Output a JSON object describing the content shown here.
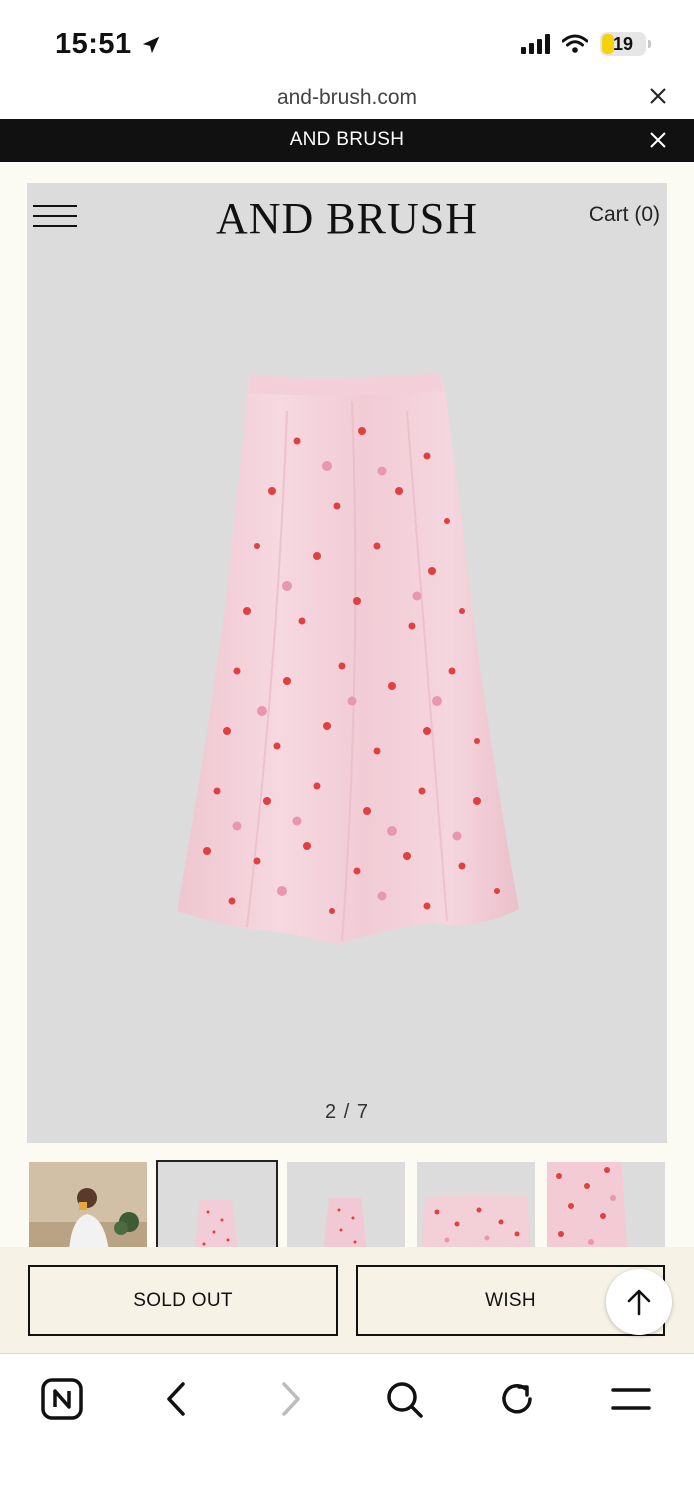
{
  "status_bar": {
    "time": "15:51",
    "battery": "19"
  },
  "url_bar": {
    "domain": "and-brush.com"
  },
  "announcement": {
    "text": "AND BRUSH"
  },
  "header": {
    "brand": "AND BRUSH",
    "cart_label": "Cart (0)"
  },
  "gallery": {
    "counter": "2 / 7",
    "current_index": 2,
    "total": 7
  },
  "actions": {
    "sold_out_label": "SOLD OUT",
    "wish_label": "WISH"
  },
  "colors": {
    "announcement_bg": "#111111",
    "hero_bg": "#dcdcdc",
    "page_bg": "#fbfaf3",
    "action_bar_bg": "#f6f3e6",
    "skirt": "#f2cfd8",
    "print": "#e0413e"
  },
  "icons": {
    "location": "location-arrow-icon",
    "signal": "cellular-signal-icon",
    "wifi": "wifi-icon",
    "close": "close-icon",
    "menu": "hamburger-menu-icon",
    "scroll_top": "arrow-up-icon",
    "browser_home": "naver-n-icon",
    "back": "chevron-left-icon",
    "forward": "chevron-right-icon",
    "search": "search-icon",
    "reload": "reload-icon",
    "browser_menu": "menu-icon"
  }
}
